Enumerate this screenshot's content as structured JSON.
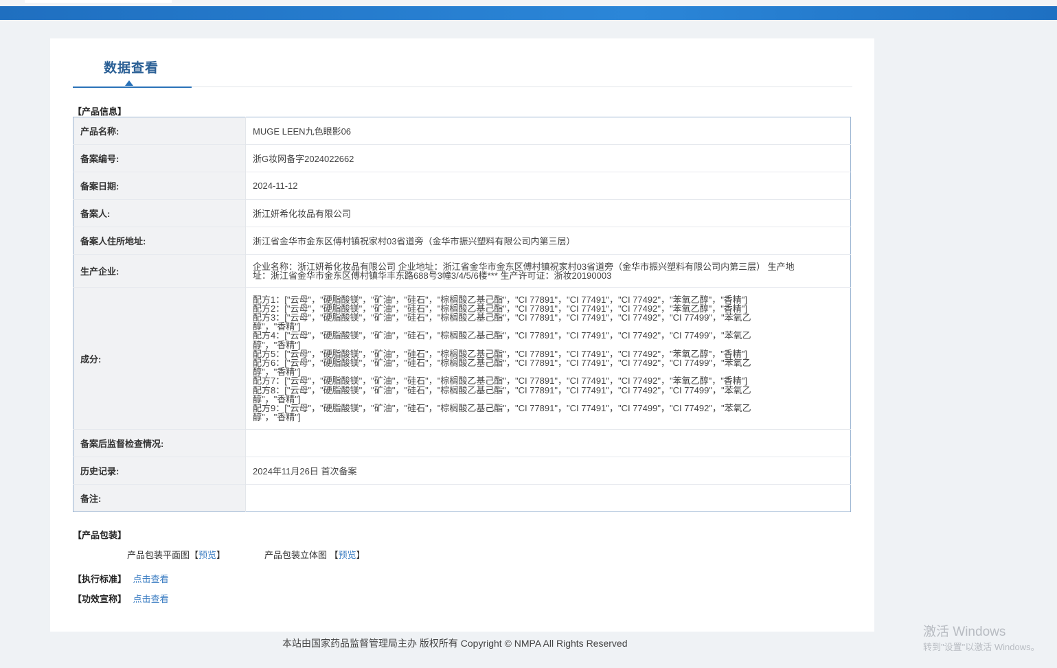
{
  "page": {
    "title": "数据查看"
  },
  "sections": {
    "product_info": "【产品信息】",
    "packaging": "【产品包装】",
    "standard": "【执行标准】",
    "efficacy": "【功效宣称】"
  },
  "product": {
    "name_label": "产品名称:",
    "name": "MUGE LEEN九色眼影06",
    "reg_no_label": "备案编号:",
    "reg_no": "浙G妆网备字2024022662",
    "reg_date_label": "备案日期:",
    "reg_date": "2024-11-12",
    "registrant_label": "备案人:",
    "registrant": "浙江妍希化妆品有限公司",
    "address_label": "备案人住所地址:",
    "address": "浙江省金华市金东区傅村镇祝家村03省道旁（金华市振兴塑料有限公司内第三层）",
    "manufacturer_label": "生产企业:",
    "manufacturer": "企业名称：浙江妍希化妆品有限公司 企业地址：浙江省金华市金东区傅村镇祝家村03省道旁（金华市振兴塑料有限公司内第三层） 生产地址：浙江省金华市金东区傅村镇华丰东路688号3幢3/4/5/6楼*** 生产许可证：浙妆20190003",
    "ingredients_label": "成分:",
    "ingredients": [
      "配方1：[\"云母\"，\"硬脂酸镁\"，\"矿油\"，\"硅石\"，\"棕榈酸乙基己酯\"，\"CI 77891\"，\"CI 77491\"，\"CI 77492\"，\"苯氧乙醇\"，\"香精\"]",
      "配方2：[\"云母\"，\"硬脂酸镁\"，\"矿油\"，\"硅石\"，\"棕榈酸乙基己酯\"，\"CI 77891\"，\"CI 77491\"，\"CI 77492\"，\"苯氧乙醇\"，\"香精\"]",
      "配方3：[\"云母\"，\"硬脂酸镁\"，\"矿油\"，\"硅石\"，\"棕榈酸乙基己酯\"，\"CI 77891\"，\"CI 77491\"，\"CI 77492\"，\"CI 77499\"，\"苯氧乙",
      "醇\"，\"香精\"]",
      "配方4：[\"云母\"，\"硬脂酸镁\"，\"矿油\"，\"硅石\"，\"棕榈酸乙基己酯\"，\"CI 77891\"，\"CI 77491\"，\"CI 77492\"，\"CI 77499\"，\"苯氧乙",
      "醇\"，\"香精\"]",
      "配方5：[\"云母\"，\"硬脂酸镁\"，\"矿油\"，\"硅石\"，\"棕榈酸乙基己酯\"，\"CI 77891\"，\"CI 77491\"，\"CI 77492\"，\"苯氧乙醇\"，\"香精\"]",
      "配方6：[\"云母\"，\"硬脂酸镁\"，\"矿油\"，\"硅石\"，\"棕榈酸乙基己酯\"，\"CI 77891\"，\"CI 77491\"，\"CI 77492\"，\"CI 77499\"，\"苯氧乙",
      "醇\"，\"香精\"]",
      "配方7：[\"云母\"，\"硬脂酸镁\"，\"矿油\"，\"硅石\"，\"棕榈酸乙基己酯\"，\"CI 77891\"，\"CI 77491\"，\"CI 77492\"，\"苯氧乙醇\"，\"香精\"]",
      "配方8：[\"云母\"，\"硬脂酸镁\"，\"矿油\"，\"硅石\"，\"棕榈酸乙基己酯\"，\"CI 77891\"，\"CI 77491\"，\"CI 77492\"，\"CI 77499\"，\"苯氧乙",
      "醇\"，\"香精\"]",
      "配方9：[\"云母\"，\"硬脂酸镁\"，\"矿油\"，\"硅石\"，\"棕榈酸乙基己酯\"，\"CI 77891\"，\"CI 77491\"，\"CI 77499\"，\"CI 77492\"，\"苯氧乙",
      "醇\"，\"香精\"]"
    ],
    "inspection_label": "备案后监督检查情况:",
    "inspection": "",
    "history_label": "历史记录:",
    "history": "2024年11月26日 首次备案",
    "remarks_label": "备注:",
    "remarks": ""
  },
  "packaging": {
    "flat_label": "产品包装平面图",
    "flat_open": "【",
    "flat_link": "预览",
    "flat_close": "】",
    "solid_label": "产品包装立体图 ",
    "solid_open": "【",
    "solid_link": "预览",
    "solid_close": "】"
  },
  "links": {
    "standard_link": "点击查看",
    "efficacy_link": "点击查看"
  },
  "footer": {
    "text": "本站由国家药品监督管理局主办 版权所有 Copyright © NMPA All Rights Reserved"
  },
  "watermark": {
    "line1": "激活 Windows",
    "line2": "转到\"设置\"以激活 Windows。"
  },
  "colors": {
    "brand_blue": "#2a72b8",
    "link_blue": "#3a7cc2",
    "label_bg": "#f1f2f4"
  }
}
